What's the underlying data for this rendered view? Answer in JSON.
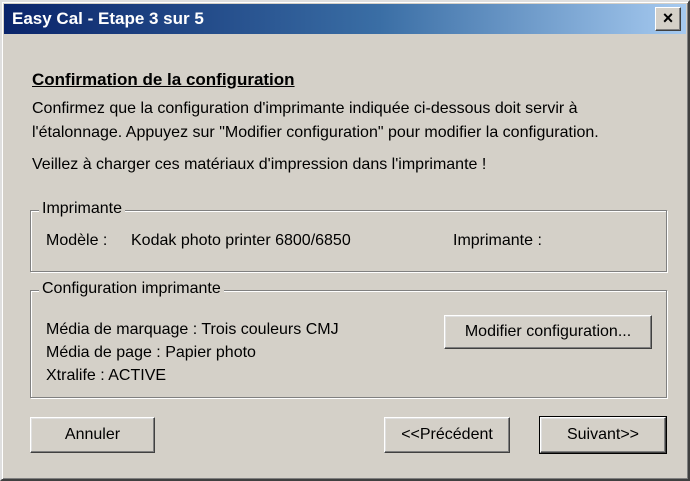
{
  "window": {
    "title": "Easy Cal - Etape 3 sur 5",
    "close_label": "×"
  },
  "content": {
    "heading": "Confirmation de la configuration",
    "instruction_line1": "Confirmez que la configuration d'imprimante indiquée ci-dessous doit servir à",
    "instruction_line2": "l'étalonnage. Appuyez sur \"Modifier configuration\" pour modifier la configuration.",
    "materials_notice": "Veillez à charger ces matériaux d'impression dans l'imprimante !"
  },
  "printer_group": {
    "title": "Imprimante",
    "model_label": "Modèle :",
    "model_value": "Kodak photo printer 6800/6850",
    "printer_label": "Imprimante :"
  },
  "config_group": {
    "title": "Configuration imprimante",
    "marking_media": "Média de marquage : Trois couleurs CMJ",
    "page_media": "Média de page : Papier photo",
    "xtralife": "Xtralife : ACTIVE",
    "modify_button": "Modifier configuration..."
  },
  "buttons": {
    "cancel": "Annuler",
    "previous": "<<Précédent",
    "next": "Suivant>>"
  },
  "colors": {
    "dialog_face": "#d4d0c8",
    "titlebar_start": "#0a246a",
    "titlebar_end": "#a6caf0"
  }
}
